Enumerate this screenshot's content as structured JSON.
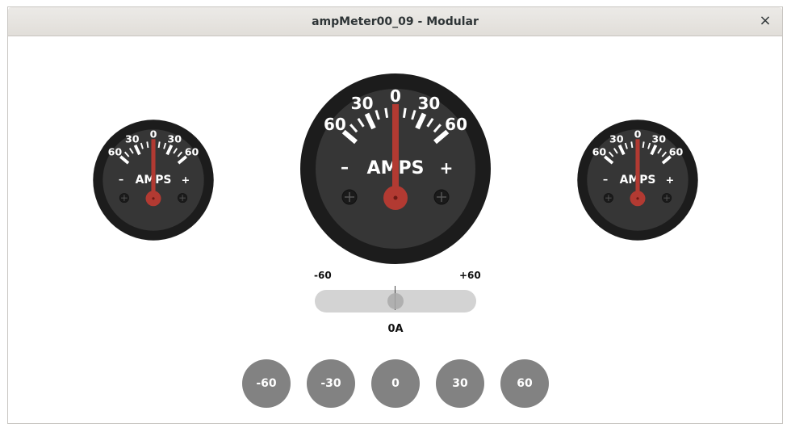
{
  "window": {
    "title": "ampMeter00_09 - Modular",
    "close_label": "×"
  },
  "gauge": {
    "min": -60,
    "max": 60,
    "value": 0,
    "tick_labels": [
      "60",
      "30",
      "0",
      "30",
      "60"
    ],
    "unit_label": "AMPS",
    "minus_label": "–",
    "plus_label": "+",
    "colors": {
      "bezel": "#1c1c1c",
      "face": "#363636",
      "needle": "#b23a32",
      "tick": "#ffffff"
    }
  },
  "slider": {
    "min_label": "-60",
    "max_label": "+60",
    "value": 0,
    "min": -60,
    "max": 60
  },
  "readout": {
    "text": "0A"
  },
  "buttons": [
    {
      "label": "-60"
    },
    {
      "label": "-30"
    },
    {
      "label": "0"
    },
    {
      "label": "30"
    },
    {
      "label": "60"
    }
  ]
}
